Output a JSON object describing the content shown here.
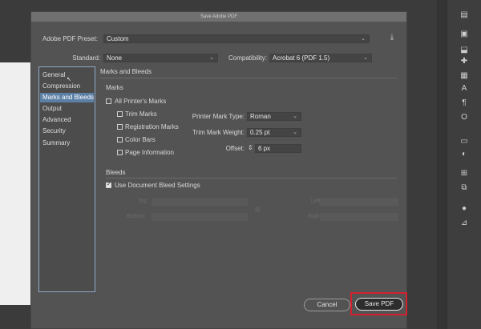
{
  "dialog": {
    "title": "Save Adobe PDF",
    "preset_label": "Adobe PDF Preset:",
    "preset_value": "Custom",
    "standard_label": "Standard:",
    "standard_value": "None",
    "compat_label": "Compatibility:",
    "compat_value": "Acrobat 6 (PDF 1.5)"
  },
  "sidebar": {
    "items": [
      {
        "label": "General"
      },
      {
        "label": "Compression"
      },
      {
        "label": "Marks and Bleeds"
      },
      {
        "label": "Output"
      },
      {
        "label": "Advanced"
      },
      {
        "label": "Security"
      },
      {
        "label": "Summary"
      }
    ]
  },
  "main": {
    "section_title": "Marks and Bleeds",
    "marks_heading": "Marks",
    "all_printers_marks": "All Printer's Marks",
    "trim_marks": "Trim Marks",
    "registration_marks": "Registration Marks",
    "color_bars": "Color Bars",
    "page_information": "Page Information",
    "printer_mark_type_label": "Printer Mark Type:",
    "printer_mark_type_value": "Roman",
    "trim_mark_weight_label": "Trim Mark Weight:",
    "trim_mark_weight_value": "0.25 pt",
    "offset_label": "Offset:",
    "offset_value": "6 px",
    "bleeds_heading": "Bleeds",
    "use_doc_bleed": "Use Document Bleed Settings",
    "top_label": "Top:",
    "bottom_label": "Bottom:",
    "left_label": "Left:",
    "right_label": "Right:"
  },
  "buttons": {
    "cancel": "Cancel",
    "save": "Save PDF"
  },
  "colors": {
    "highlight": "#d2202f",
    "selected": "#5c7fa6"
  }
}
